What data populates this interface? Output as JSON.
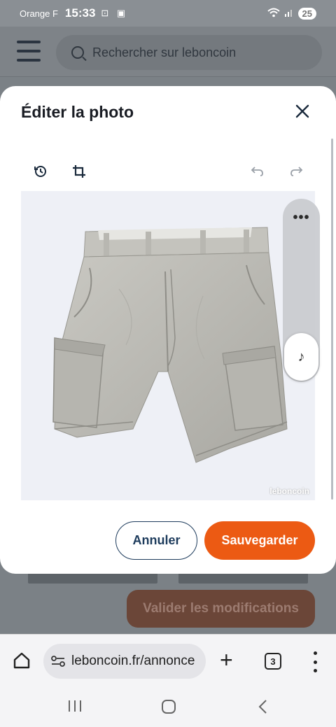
{
  "status_bar": {
    "carrier": "Orange F",
    "time": "15:33",
    "battery": "25"
  },
  "page": {
    "search_placeholder": "Rechercher sur leboncoin",
    "validate_label": "Valider les modifications"
  },
  "modal": {
    "title": "Éditer la photo",
    "watermark": "leboncoin",
    "cancel_label": "Annuler",
    "save_label": "Sauvegarder"
  },
  "browser": {
    "url": "leboncoin.fr/annonce",
    "tab_count": "3"
  },
  "colors": {
    "accent": "#ec5a13",
    "navy": "#1d3b5c"
  }
}
